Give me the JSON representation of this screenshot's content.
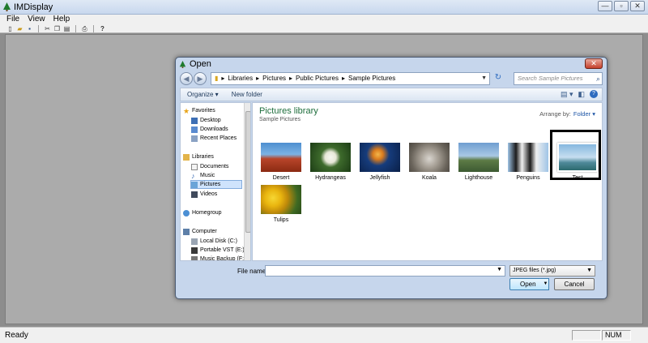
{
  "app": {
    "title": "IMDisplay",
    "menu": [
      "File",
      "View",
      "Help"
    ],
    "status_text": "Ready",
    "status_num": "NUM"
  },
  "dialog": {
    "title": "Open",
    "breadcrumb": [
      "Libraries",
      "Pictures",
      "Public Pictures",
      "Sample Pictures"
    ],
    "search_placeholder": "Search Sample Pictures",
    "organize": "Organize ▾",
    "new_folder": "New folder",
    "library_title": "Pictures library",
    "library_subtitle": "Sample Pictures",
    "arrange_label": "Arrange by:",
    "arrange_value": "Folder ▾",
    "nav": {
      "favorites": "Favorites",
      "desktop": "Desktop",
      "downloads": "Downloads",
      "recent": "Recent Places",
      "libraries": "Libraries",
      "documents": "Documents",
      "music": "Music",
      "pictures": "Pictures",
      "videos": "Videos",
      "homegroup": "Homegroup",
      "computer": "Computer",
      "local_disk": "Local Disk (C:)",
      "portable": "Portable VST (E:)",
      "music_backup": "Music Backup (F:"
    },
    "files": [
      "Desert",
      "Hydrangeas",
      "Jellyfish",
      "Koala",
      "Lighthouse",
      "Penguins",
      "Test",
      "Tulips"
    ],
    "file_name_label": "File name:",
    "file_name_value": "",
    "file_type": "JPEG files (*.jpg)",
    "open_label": "Open",
    "cancel_label": "Cancel"
  }
}
